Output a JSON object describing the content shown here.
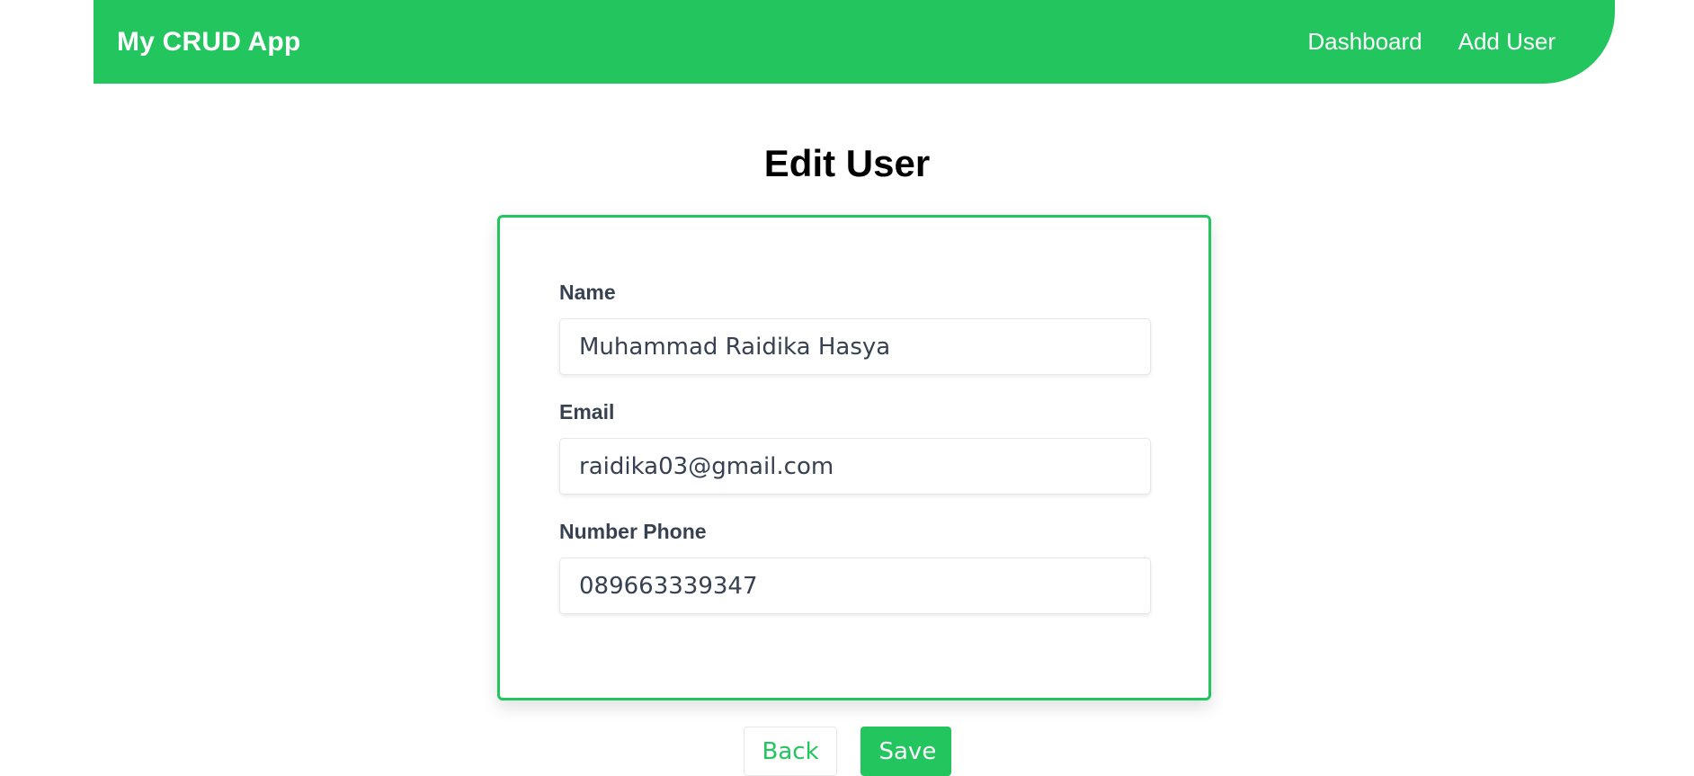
{
  "navbar": {
    "brand": "My CRUD App",
    "links": [
      {
        "label": "Dashboard"
      },
      {
        "label": "Add User"
      }
    ],
    "background_color": "#22c55e"
  },
  "page": {
    "title": "Edit User"
  },
  "form": {
    "name": {
      "label": "Name",
      "value": "Muhammad Raidika Hasya"
    },
    "email": {
      "label": "Email",
      "value": "raidika03@gmail.com"
    },
    "phone": {
      "label": "Number Phone",
      "value": "089663339347"
    },
    "border_color": "#22c55e"
  },
  "actions": {
    "back_label": "Back",
    "save_label": "Save",
    "accent_color": "#22c55e"
  }
}
